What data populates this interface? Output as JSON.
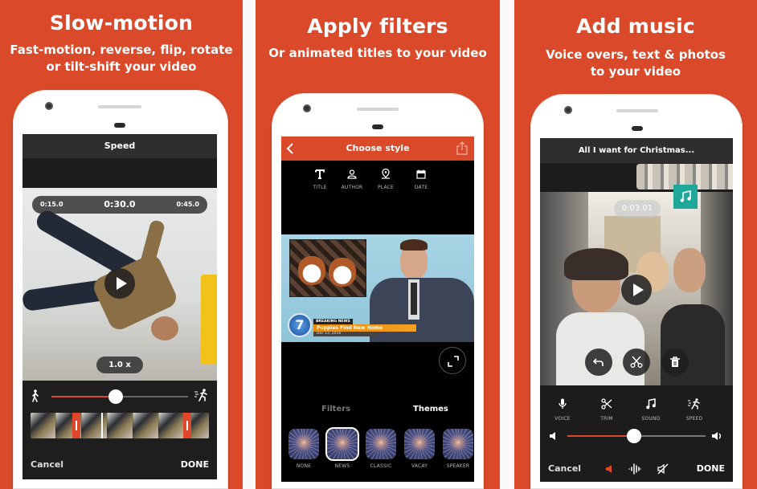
{
  "colors": {
    "brand": "#d9492a",
    "teal": "#1fa79a",
    "dark": "#1c1c1c"
  },
  "panels": [
    {
      "headline": "Slow-motion",
      "subtitle_lines": [
        "Fast-motion, reverse, flip, rotate",
        "or tilt-shift your video"
      ],
      "screen": {
        "title": "Speed",
        "timeline": {
          "left": "0:15.0",
          "center": "0:30.0",
          "right": "0:45.0"
        },
        "speed_badge": "1.0 x",
        "speed_slider": {
          "value_fraction": 0.47,
          "min_icon": "walk-icon",
          "max_icon": "run-fast-icon"
        },
        "cancel_label": "Cancel",
        "done_label": "DONE"
      }
    },
    {
      "headline": "Apply filters",
      "subtitle_lines": [
        "Or animated titles to your video"
      ],
      "screen": {
        "title": "Choose style",
        "back_icon": "chevron-left-icon",
        "share_icon": "share-icon",
        "tools": [
          {
            "label": "TITLE",
            "icon": "text-icon"
          },
          {
            "label": "AUTHOR",
            "icon": "person-icon"
          },
          {
            "label": "PLACE",
            "icon": "location-pin-icon"
          },
          {
            "label": "DATE",
            "icon": "calendar-icon"
          }
        ],
        "news_overlay": {
          "tag": "BREAKING NEWS",
          "headline": "Puppies Find New Home",
          "date": "Dec 13, 2016",
          "channel": "7"
        },
        "tabs": [
          {
            "label": "Filters",
            "active": false
          },
          {
            "label": "Themes",
            "active": true
          }
        ],
        "themes": [
          {
            "label": "NONE",
            "selected": false
          },
          {
            "label": "NEWS",
            "selected": true
          },
          {
            "label": "CLASSIC",
            "selected": false
          },
          {
            "label": "VACAY",
            "selected": false
          },
          {
            "label": "SPEAKER",
            "selected": false
          }
        ]
      }
    },
    {
      "headline": "Add music",
      "subtitle_lines": [
        "Voice overs, text & photos",
        "to your video"
      ],
      "screen": {
        "title": "All I want for Christmas...",
        "timestamp": "0:03.01",
        "tools": [
          {
            "label": "VOICE",
            "icon": "microphone-icon"
          },
          {
            "label": "TRIM",
            "icon": "scissors-icon"
          },
          {
            "label": "SOUND",
            "icon": "music-note-icon"
          },
          {
            "label": "SPEED",
            "icon": "run-fast-icon"
          }
        ],
        "volume_slider": {
          "value_fraction": 0.48
        },
        "cancel_label": "Cancel",
        "done_label": "DONE"
      }
    }
  ]
}
